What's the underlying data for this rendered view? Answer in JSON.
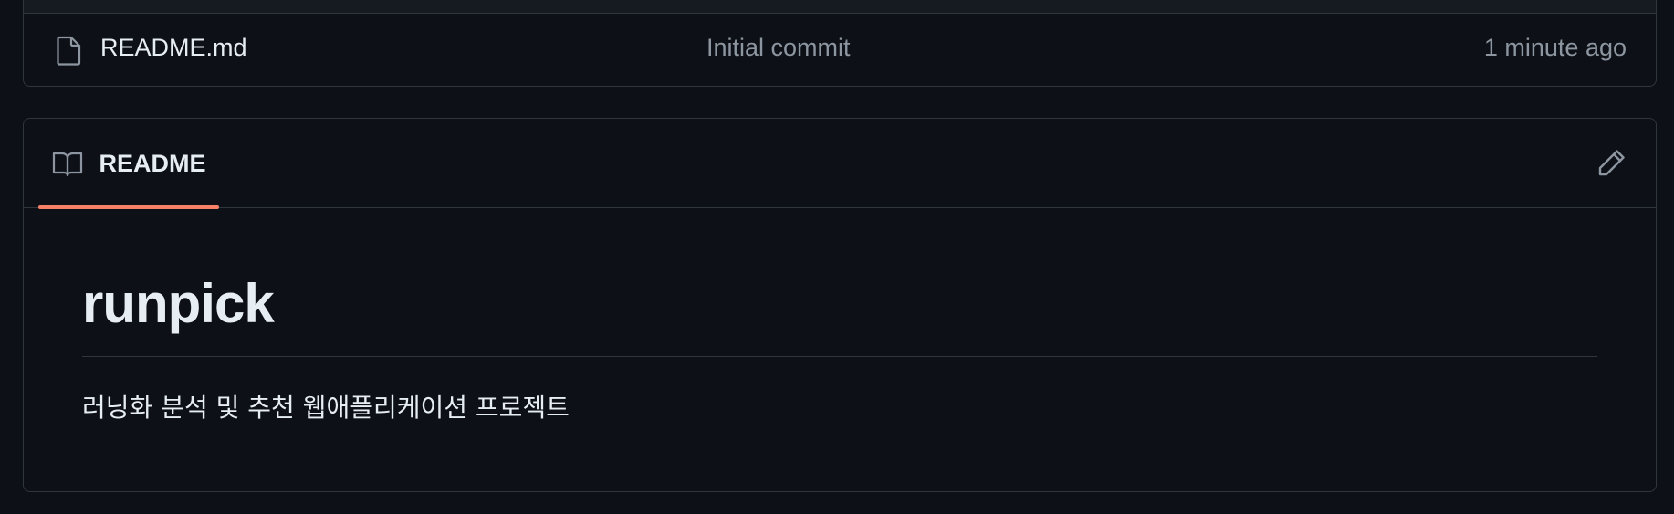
{
  "file_list": {
    "rows": [
      {
        "name": "README.md",
        "commit_message": "Initial commit",
        "time": "1 minute ago",
        "icon": "file-icon"
      }
    ]
  },
  "readme": {
    "tab_label": "README",
    "tab_icon": "book-icon",
    "edit_icon": "pencil-icon",
    "title": "runpick",
    "description": "러닝화 분석 및 추천 웹애플리케이션 프로젝트"
  },
  "colors": {
    "background": "#0d1117",
    "border": "#30363d",
    "muted_text": "#8d96a0",
    "active_tab_accent": "#f78166"
  }
}
